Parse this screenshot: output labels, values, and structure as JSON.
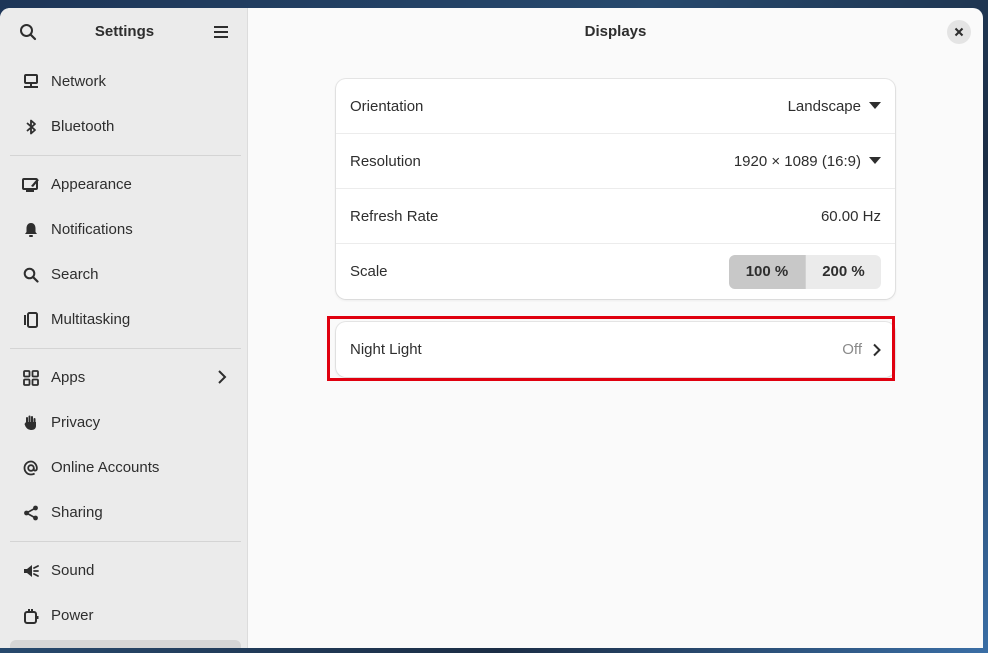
{
  "sidebar": {
    "title": "Settings",
    "groups": [
      [
        {
          "label": "Network",
          "icon": "network-icon"
        },
        {
          "label": "Bluetooth",
          "icon": "bluetooth-icon"
        }
      ],
      [
        {
          "label": "Appearance",
          "icon": "appearance-icon"
        },
        {
          "label": "Notifications",
          "icon": "bell-icon"
        },
        {
          "label": "Search",
          "icon": "search-icon"
        },
        {
          "label": "Multitasking",
          "icon": "multitasking-icon"
        }
      ],
      [
        {
          "label": "Apps",
          "icon": "apps-grid-icon"
        },
        {
          "label": "Privacy",
          "icon": "hand-icon"
        },
        {
          "label": "Online Accounts",
          "icon": "at-sign-icon"
        },
        {
          "label": "Sharing",
          "icon": "share-icon"
        }
      ],
      [
        {
          "label": "Sound",
          "icon": "speaker-icon"
        },
        {
          "label": "Power",
          "icon": "power-plug-icon"
        }
      ]
    ]
  },
  "main": {
    "title": "Displays",
    "rows": {
      "orientation": {
        "label": "Orientation",
        "value": "Landscape"
      },
      "resolution": {
        "label": "Resolution",
        "value": "1920 × 1089 (16:9)"
      },
      "refresh": {
        "label": "Refresh Rate",
        "value": "60.00 Hz"
      },
      "scale": {
        "label": "Scale",
        "options": [
          "100 %",
          "200 %"
        ],
        "selected": "100 %"
      }
    },
    "night_light": {
      "label": "Night Light",
      "value": "Off"
    }
  },
  "colors": {
    "highlight": "#e0000f",
    "sidebar_bg": "#ebebeb",
    "main_bg": "#fafafa"
  }
}
